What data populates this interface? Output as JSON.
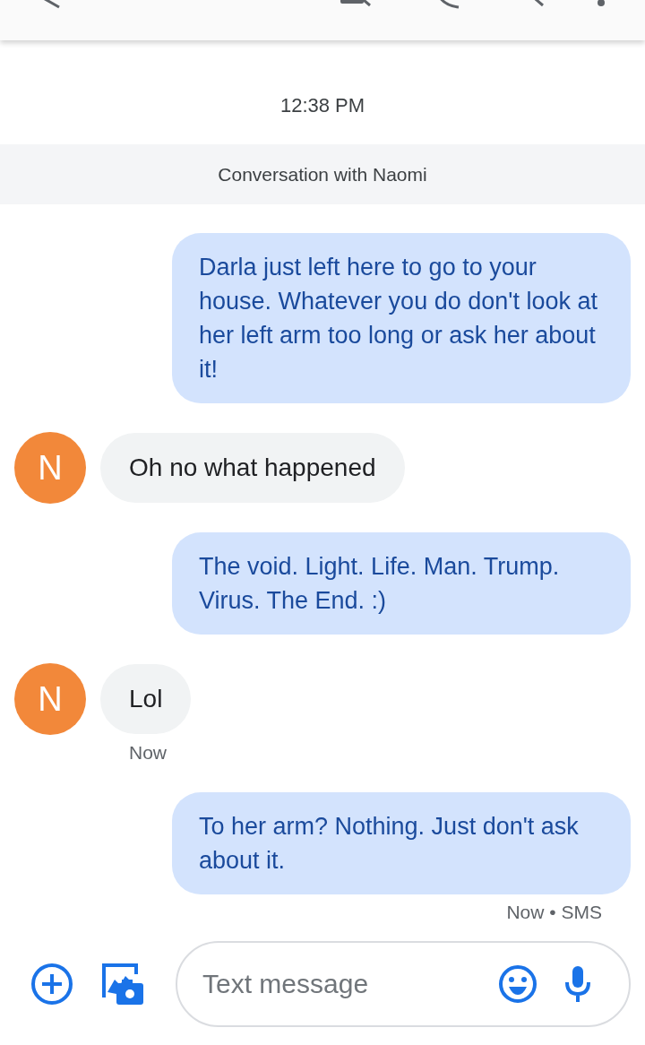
{
  "timestamp": "12:38 PM",
  "banner": "Conversation with Naomi",
  "messages": [
    {
      "kind": "outgoing",
      "text": "Darla just left here to go to your house. Whatever you do don't look at her left arm too long or ask her about it!"
    },
    {
      "kind": "incoming",
      "avatar": "N",
      "color": "#f2883a",
      "text": "Oh no what happened"
    },
    {
      "kind": "outgoing",
      "text": "The void. Light. Life. Man. Trump. Virus. The End. :)"
    },
    {
      "kind": "incoming",
      "avatar": "N",
      "color": "#f2883a",
      "text": "Lol",
      "meta": "Now"
    },
    {
      "kind": "outgoing",
      "text": "To her arm? Nothing. Just don't ask about it.",
      "meta": "Now • SMS"
    }
  ],
  "composer": {
    "placeholder": "Text message"
  }
}
